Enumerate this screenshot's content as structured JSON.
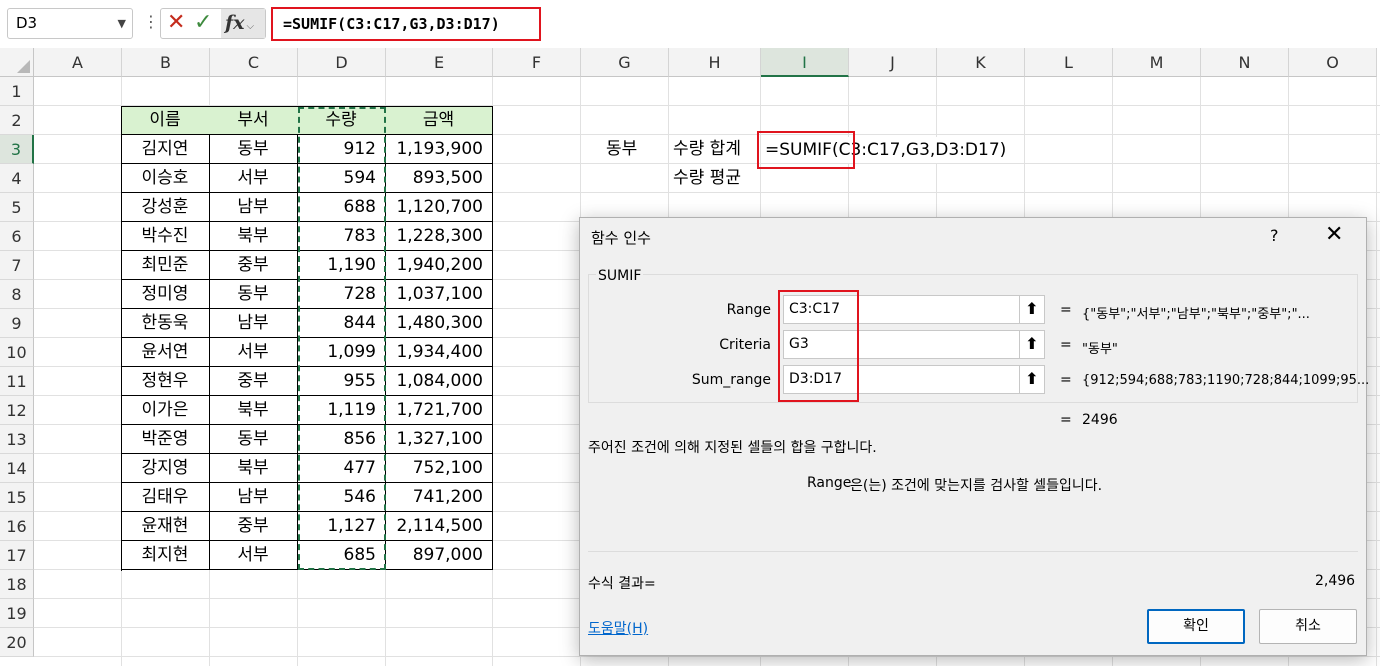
{
  "formula_bar": {
    "name_box": "D3",
    "formula": "=SUMIF(C3:C17,G3,D3:D17)"
  },
  "columns": [
    "A",
    "B",
    "C",
    "D",
    "E",
    "F",
    "G",
    "H",
    "I",
    "J",
    "K",
    "L",
    "M",
    "N",
    "O"
  ],
  "rows": [
    "1",
    "2",
    "3",
    "4",
    "5",
    "6",
    "7",
    "8",
    "9",
    "10",
    "11",
    "12",
    "13",
    "14",
    "15",
    "16",
    "17",
    "18",
    "19",
    "20"
  ],
  "table": {
    "headers": [
      "이름",
      "부서",
      "수량",
      "금액"
    ],
    "rows": [
      [
        "김지연",
        "동부",
        "912",
        "1,193,900"
      ],
      [
        "이승호",
        "서부",
        "594",
        "893,500"
      ],
      [
        "강성훈",
        "남부",
        "688",
        "1,120,700"
      ],
      [
        "박수진",
        "북부",
        "783",
        "1,228,300"
      ],
      [
        "최민준",
        "중부",
        "1,190",
        "1,940,200"
      ],
      [
        "정미영",
        "동부",
        "728",
        "1,037,100"
      ],
      [
        "한동욱",
        "남부",
        "844",
        "1,480,300"
      ],
      [
        "윤서연",
        "서부",
        "1,099",
        "1,934,400"
      ],
      [
        "정현우",
        "중부",
        "955",
        "1,084,000"
      ],
      [
        "이가은",
        "북부",
        "1,119",
        "1,721,700"
      ],
      [
        "박준영",
        "동부",
        "856",
        "1,327,100"
      ],
      [
        "강지영",
        "북부",
        "477",
        "752,100"
      ],
      [
        "김태우",
        "남부",
        "546",
        "741,200"
      ],
      [
        "윤재현",
        "중부",
        "1,127",
        "2,114,500"
      ],
      [
        "최지현",
        "서부",
        "685",
        "897,000"
      ]
    ]
  },
  "side": {
    "g3": "동부",
    "h3": "수량 합계",
    "h4": "수량 평균",
    "i3": "=SUMIF(C3:C17,G3,D3:D17)"
  },
  "dialog": {
    "title": "함수 인수",
    "help": "?",
    "close": "✕",
    "function_name": "SUMIF",
    "args": [
      {
        "label": "Range",
        "value": "C3:C17",
        "result": "{\"동부\";\"서부\";\"남부\";\"북부\";\"중부\";\"..."
      },
      {
        "label": "Criteria",
        "value": "G3",
        "result": "\"동부\""
      },
      {
        "label": "Sum_range",
        "value": "D3:D17",
        "result": "{912;594;688;783;1190;728;844;1099;95..."
      }
    ],
    "equals": "=",
    "total": "2496",
    "description": "주어진 조건에 의해 지정된 셀들의 합을 구합니다.",
    "arg_name": "Range",
    "arg_description": "은(는) 조건에 맞는지를 검사할 셀들입니다.",
    "result_label": "수식 결과=",
    "result_value": "2,496",
    "help_link": "도움말(H)",
    "ok": "확인",
    "cancel": "취소"
  },
  "colors": {
    "header_fill": "#d9f2d0",
    "selection_green": "#217346",
    "highlight_red": "#e0141e"
  }
}
